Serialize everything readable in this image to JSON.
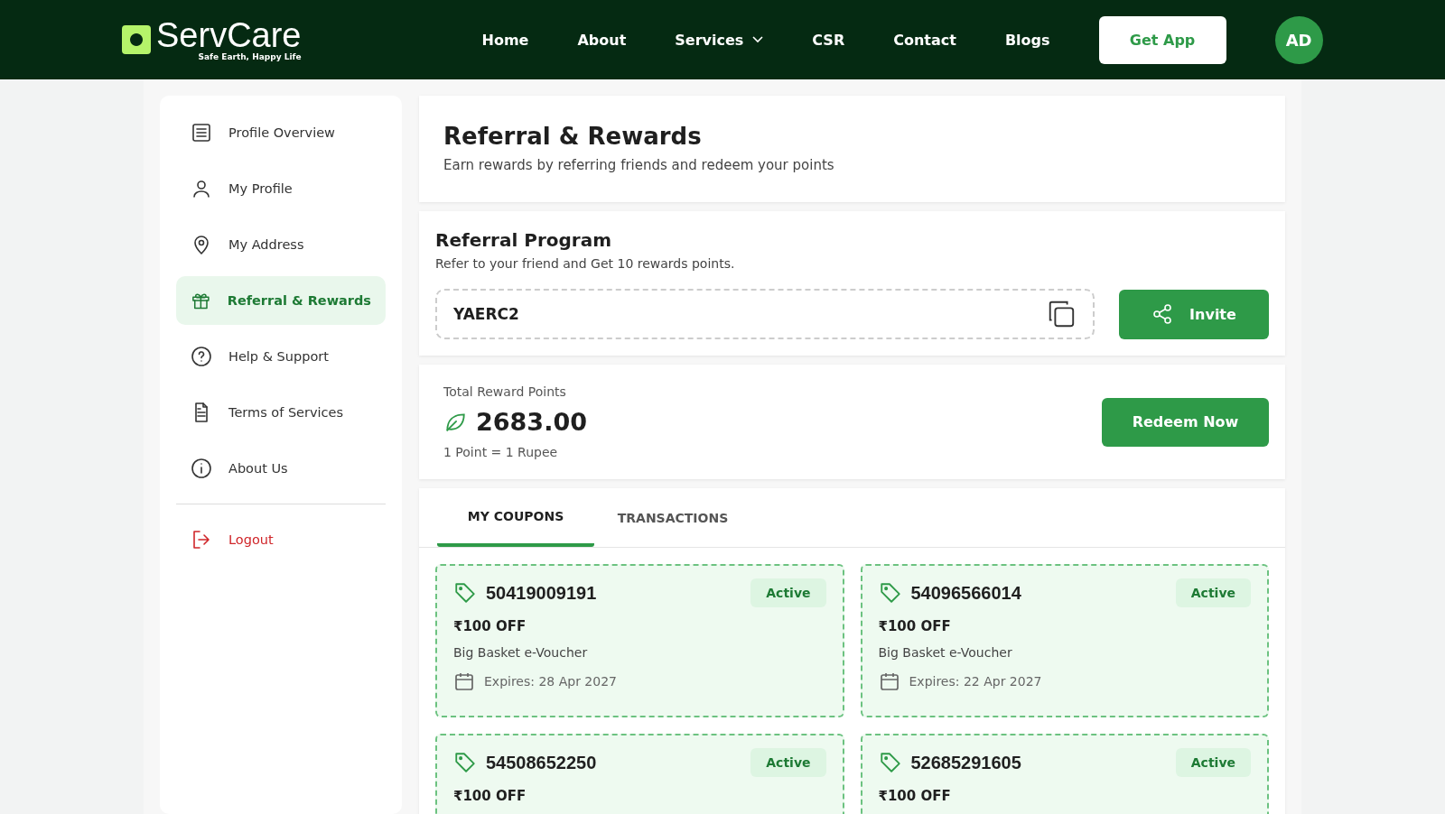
{
  "header": {
    "logo": "ServCare",
    "tagline": "Safe Earth, Happy Life",
    "nav": [
      {
        "label": "Home",
        "dropdown": false
      },
      {
        "label": "About",
        "dropdown": false
      },
      {
        "label": "Services",
        "dropdown": true
      },
      {
        "label": "CSR",
        "dropdown": false
      },
      {
        "label": "Contact",
        "dropdown": false
      },
      {
        "label": "Blogs",
        "dropdown": false
      }
    ],
    "cta": "Get App",
    "avatar": "AD"
  },
  "sidebar": {
    "items": [
      {
        "label": "Profile Overview",
        "kind": "link",
        "selected": false
      },
      {
        "label": "My Profile",
        "kind": "link",
        "selected": false
      },
      {
        "label": "My Address",
        "kind": "link",
        "selected": false
      },
      {
        "label": "Referral & Rewards",
        "kind": "link",
        "selected": true
      },
      {
        "label": "Help & Support",
        "kind": "link",
        "selected": false
      },
      {
        "label": "Terms of Services",
        "kind": "link",
        "selected": false
      },
      {
        "label": "About Us",
        "kind": "link",
        "selected": false
      },
      {
        "label": "Logout",
        "kind": "logout",
        "selected": false
      }
    ]
  },
  "page": {
    "title": "Referral & Rewards",
    "subtitle": "Earn rewards by referring friends and redeem your points"
  },
  "referral": {
    "title": "Referral Program",
    "description": "Refer to your friend and Get 10 rewards points.",
    "code": "YAERC2",
    "button": "Invite"
  },
  "points": {
    "label": "Total Reward Points",
    "value": "2683.00",
    "rate": "1 Point = 1 Rupee",
    "button": "Redeem Now"
  },
  "tabs": [
    {
      "label": "MY COUPONS",
      "selected": true
    },
    {
      "label": "TRANSACTIONS",
      "selected": false
    }
  ],
  "coupons": [
    {
      "code": "50419009191",
      "status": "Active",
      "amount": "₹100 OFF",
      "name": "Big Basket e-Voucher",
      "expiry": "Expires: 28 Apr 2027"
    },
    {
      "code": "54096566014",
      "status": "Active",
      "amount": "₹100 OFF",
      "name": "Big Basket e-Voucher",
      "expiry": "Expires: 22 Apr 2027"
    },
    {
      "code": "54508652250",
      "status": "Active",
      "amount": "₹100 OFF"
    },
    {
      "code": "52685291605",
      "status": "Active",
      "amount": "₹100 OFF"
    }
  ]
}
